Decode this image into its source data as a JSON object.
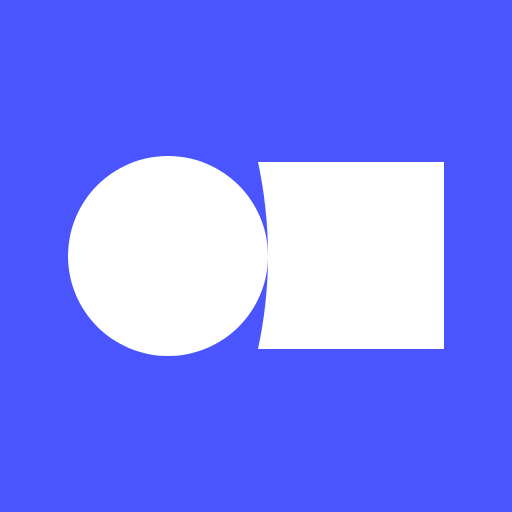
{
  "icon": {
    "name": "circle-and-square-logo",
    "colors": {
      "background": "#4A55FF",
      "foreground": "#FFFFFF"
    },
    "shapes": [
      "circle",
      "square-with-concave-left-edge"
    ]
  }
}
